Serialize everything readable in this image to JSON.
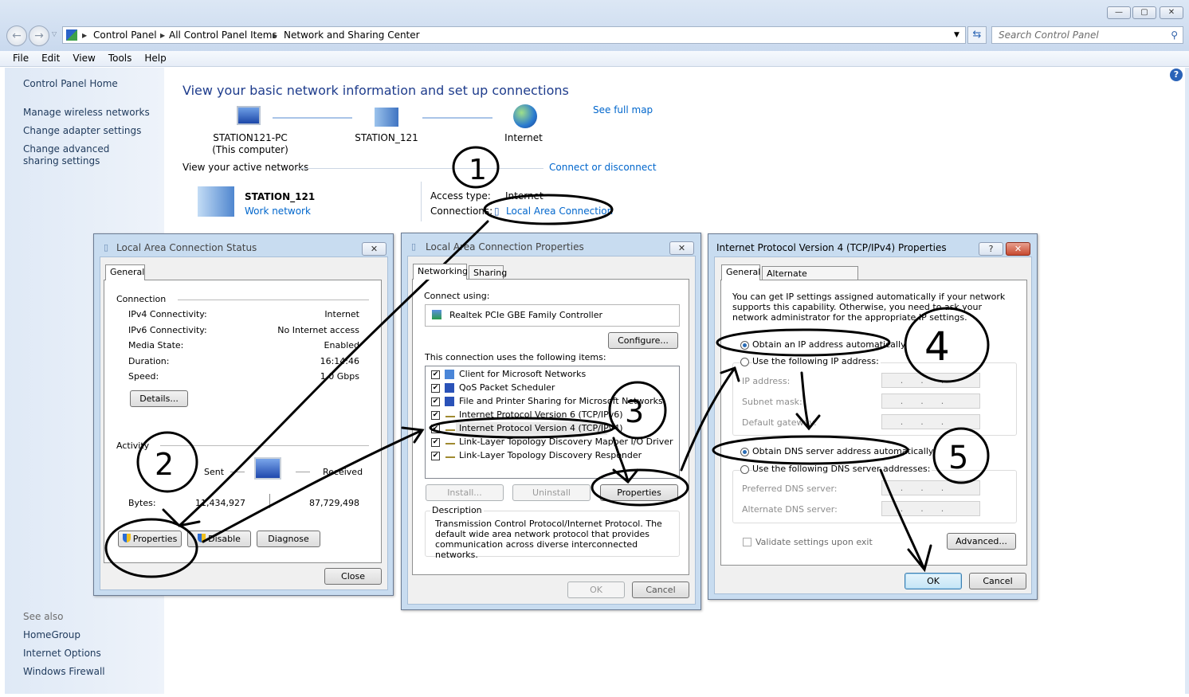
{
  "window": {
    "minimize": "—",
    "maximize": "▢",
    "close": "✕"
  },
  "address_bar": {
    "crumbs": [
      "Control Panel",
      "All Control Panel Items",
      "Network and Sharing Center"
    ],
    "search_placeholder": "Search Control Panel"
  },
  "menu": [
    "File",
    "Edit",
    "View",
    "Tools",
    "Help"
  ],
  "sidebar": {
    "home": "Control Panel Home",
    "items": [
      "Manage wireless networks",
      "Change adapter settings",
      "Change advanced sharing settings"
    ],
    "see_also": "See also",
    "see_also_items": [
      "HomeGroup",
      "Internet Options",
      "Windows Firewall"
    ]
  },
  "main": {
    "title": "View your basic network information and set up connections",
    "see_full_map": "See full map",
    "map": {
      "computer": "STATION121-PC",
      "computer_sub": "(This computer)",
      "network": "STATION_121",
      "internet": "Internet"
    },
    "active_networks": "View your active networks",
    "connect_disconnect": "Connect or disconnect",
    "network_name": "STATION_121",
    "network_type": "Work network",
    "access_type_label": "Access type:",
    "access_type": "Internet",
    "connections_label": "Connections:",
    "connection": "Local Area Connection"
  },
  "status_dialog": {
    "title": "Local Area Connection Status",
    "tab": "General",
    "connection_heading": "Connection",
    "rows": [
      {
        "label": "IPv4 Connectivity:",
        "value": "Internet"
      },
      {
        "label": "IPv6 Connectivity:",
        "value": "No Internet access"
      },
      {
        "label": "Media State:",
        "value": "Enabled"
      },
      {
        "label": "Duration:",
        "value": "16:14:46"
      },
      {
        "label": "Speed:",
        "value": "1.0 Gbps"
      }
    ],
    "details": "Details...",
    "activity_heading": "Activity",
    "sent": "Sent",
    "received": "Received",
    "bytes_label": "Bytes:",
    "bytes_sent": "11,434,927",
    "bytes_received": "87,729,498",
    "properties": "Properties",
    "disable": "Disable",
    "diagnose": "Diagnose",
    "close": "Close"
  },
  "props_dialog": {
    "title": "Local Area Connection Properties",
    "tabs": [
      "Networking",
      "Sharing"
    ],
    "connect_using": "Connect using:",
    "adapter": "Realtek PCIe GBE Family Controller",
    "configure": "Configure...",
    "items_label": "This connection uses the following items:",
    "items": [
      {
        "label": "Client for Microsoft Networks",
        "checked": true
      },
      {
        "label": "QoS Packet Scheduler",
        "checked": true
      },
      {
        "label": "File and Printer Sharing for Microsoft Networks",
        "checked": true
      },
      {
        "label": "Internet Protocol Version 6 (TCP/IPv6)",
        "checked": true
      },
      {
        "label": "Internet Protocol Version 4 (TCP/IPv4)",
        "checked": true,
        "selected": true
      },
      {
        "label": "Link-Layer Topology Discovery Mapper I/O Driver",
        "checked": true
      },
      {
        "label": "Link-Layer Topology Discovery Responder",
        "checked": true
      }
    ],
    "install": "Install...",
    "uninstall": "Uninstall",
    "properties": "Properties",
    "description_label": "Description",
    "description": "Transmission Control Protocol/Internet Protocol. The default wide area network protocol that provides communication across diverse interconnected networks.",
    "ok": "OK",
    "cancel": "Cancel"
  },
  "ipv4_dialog": {
    "title": "Internet Protocol Version 4 (TCP/IPv4) Properties",
    "help": "?",
    "tabs": [
      "General",
      "Alternate Configuration"
    ],
    "intro": "You can get IP settings assigned automatically if your network supports this capability. Otherwise, you need to ask your network administrator for the appropriate IP settings.",
    "obtain_ip": "Obtain an IP address automatically",
    "use_ip": "Use the following IP address:",
    "ip_address": "IP address:",
    "subnet_mask": "Subnet mask:",
    "default_gateway": "Default gateway:",
    "ip_placeholder": "...",
    "obtain_dns": "Obtain DNS server address automatically",
    "use_dns": "Use the following DNS server addresses:",
    "preferred_dns": "Preferred DNS server:",
    "alternate_dns": "Alternate DNS server:",
    "validate": "Validate settings upon exit",
    "advanced": "Advanced...",
    "ok": "OK",
    "cancel": "Cancel",
    "obtain_ip_selected": true,
    "obtain_dns_selected": true
  },
  "annotations": [
    "1",
    "2",
    "3",
    "4",
    "5"
  ]
}
